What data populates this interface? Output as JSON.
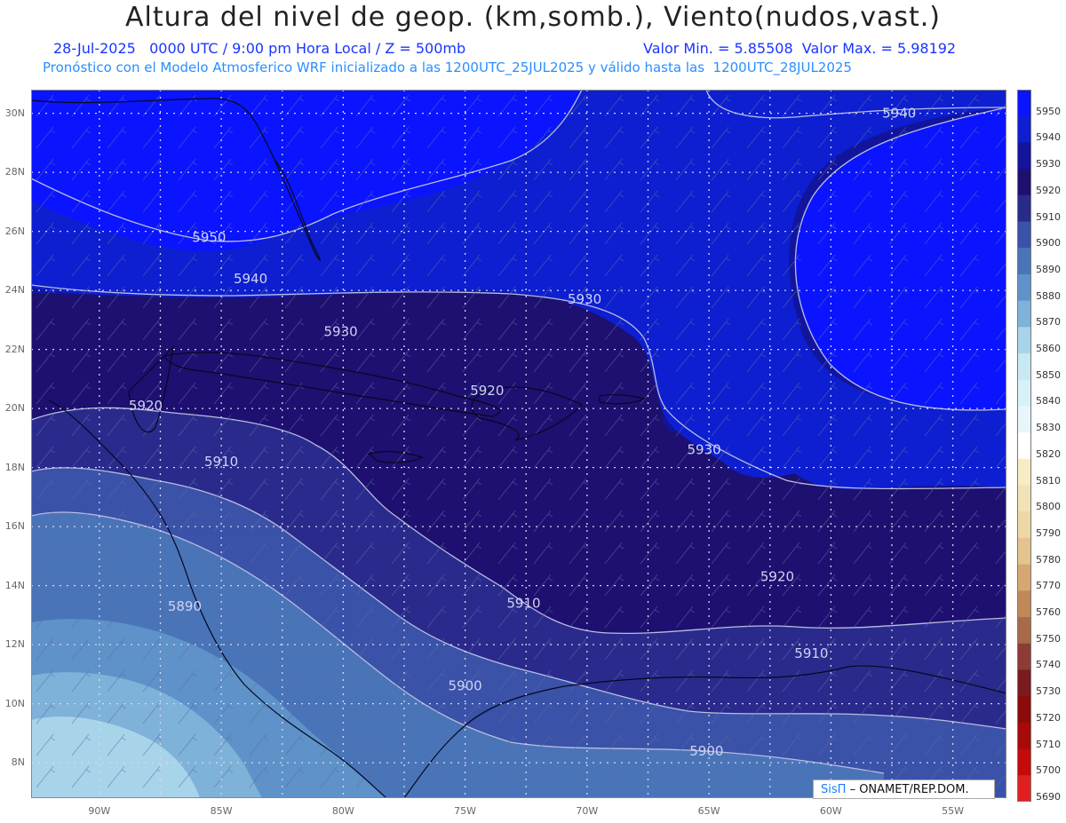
{
  "header": {
    "title": "Altura del nivel de geop. (km,somb.), Viento(nudos,vast.)",
    "line1_left": "28-Jul-2025   0000 UTC / 9:00 pm Hora Local / Z = 500mb",
    "line1_right": "Valor Min. = 5.85508  Valor Max. = 5.98192",
    "line2": "Pronóstico con el Modelo Atmosferico WRF inicializado a las 1200UTC_25JUL2025 y válido hasta las  1200UTC_28JUL2025"
  },
  "axes": {
    "lat_labels": [
      "30N",
      "28N",
      "26N",
      "24N",
      "22N",
      "20N",
      "18N",
      "16N",
      "14N",
      "12N",
      "10N",
      "8N"
    ],
    "lon_labels": [
      "90W",
      "85W",
      "80W",
      "75W",
      "70W",
      "65W",
      "60W",
      "55W"
    ]
  },
  "contour_labels": [
    {
      "text": "5940",
      "lon": -57.2,
      "lat": 30.0
    },
    {
      "text": "5950",
      "lon": -85.5,
      "lat": 25.8
    },
    {
      "text": "5940",
      "lon": -83.8,
      "lat": 24.4
    },
    {
      "text": "5930",
      "lon": -80.1,
      "lat": 22.6
    },
    {
      "text": "5930",
      "lon": -70.1,
      "lat": 23.7
    },
    {
      "text": "5920",
      "lon": -88.1,
      "lat": 20.1
    },
    {
      "text": "5920",
      "lon": -74.1,
      "lat": 20.6
    },
    {
      "text": "5930",
      "lon": -65.2,
      "lat": 18.6
    },
    {
      "text": "5910",
      "lon": -85.0,
      "lat": 18.2
    },
    {
      "text": "5920",
      "lon": -62.2,
      "lat": 14.3
    },
    {
      "text": "5910",
      "lon": -72.6,
      "lat": 13.4
    },
    {
      "text": "5910",
      "lon": -60.8,
      "lat": 11.7
    },
    {
      "text": "5890",
      "lon": -86.5,
      "lat": 13.3
    },
    {
      "text": "5900",
      "lon": -75.0,
      "lat": 10.6
    },
    {
      "text": "5900",
      "lon": -65.1,
      "lat": 8.4
    }
  ],
  "colorbar": {
    "levels": [
      "5950",
      "5940",
      "5930",
      "5920",
      "5910",
      "5900",
      "5890",
      "5880",
      "5870",
      "5860",
      "5850",
      "5840",
      "5830",
      "5820",
      "5810",
      "5800",
      "5790",
      "5780",
      "5770",
      "5760",
      "5750",
      "5740",
      "5730",
      "5720",
      "5710",
      "5700",
      "5690"
    ],
    "colors": [
      "#0a14ff",
      "#0d1fd0",
      "#12159c",
      "#1d1070",
      "#2a2a8c",
      "#3a52a8",
      "#4a74b8",
      "#5e92c8",
      "#7fb2d8",
      "#a8d4ea",
      "#c8e8f4",
      "#d8f0f8",
      "#e6f6fb",
      "#ffffff",
      "#f7ecc4",
      "#f2e2b6",
      "#edd7a6",
      "#e3c48e",
      "#d4a870",
      "#c08858",
      "#a86a48",
      "#8c3c34",
      "#7a1a1e",
      "#8c0a0a",
      "#a80a0a",
      "#c40a0a",
      "#e02020"
    ]
  },
  "credit": {
    "logo": "SisΠ",
    "text": "– ONAMET/REP.DOM."
  }
}
